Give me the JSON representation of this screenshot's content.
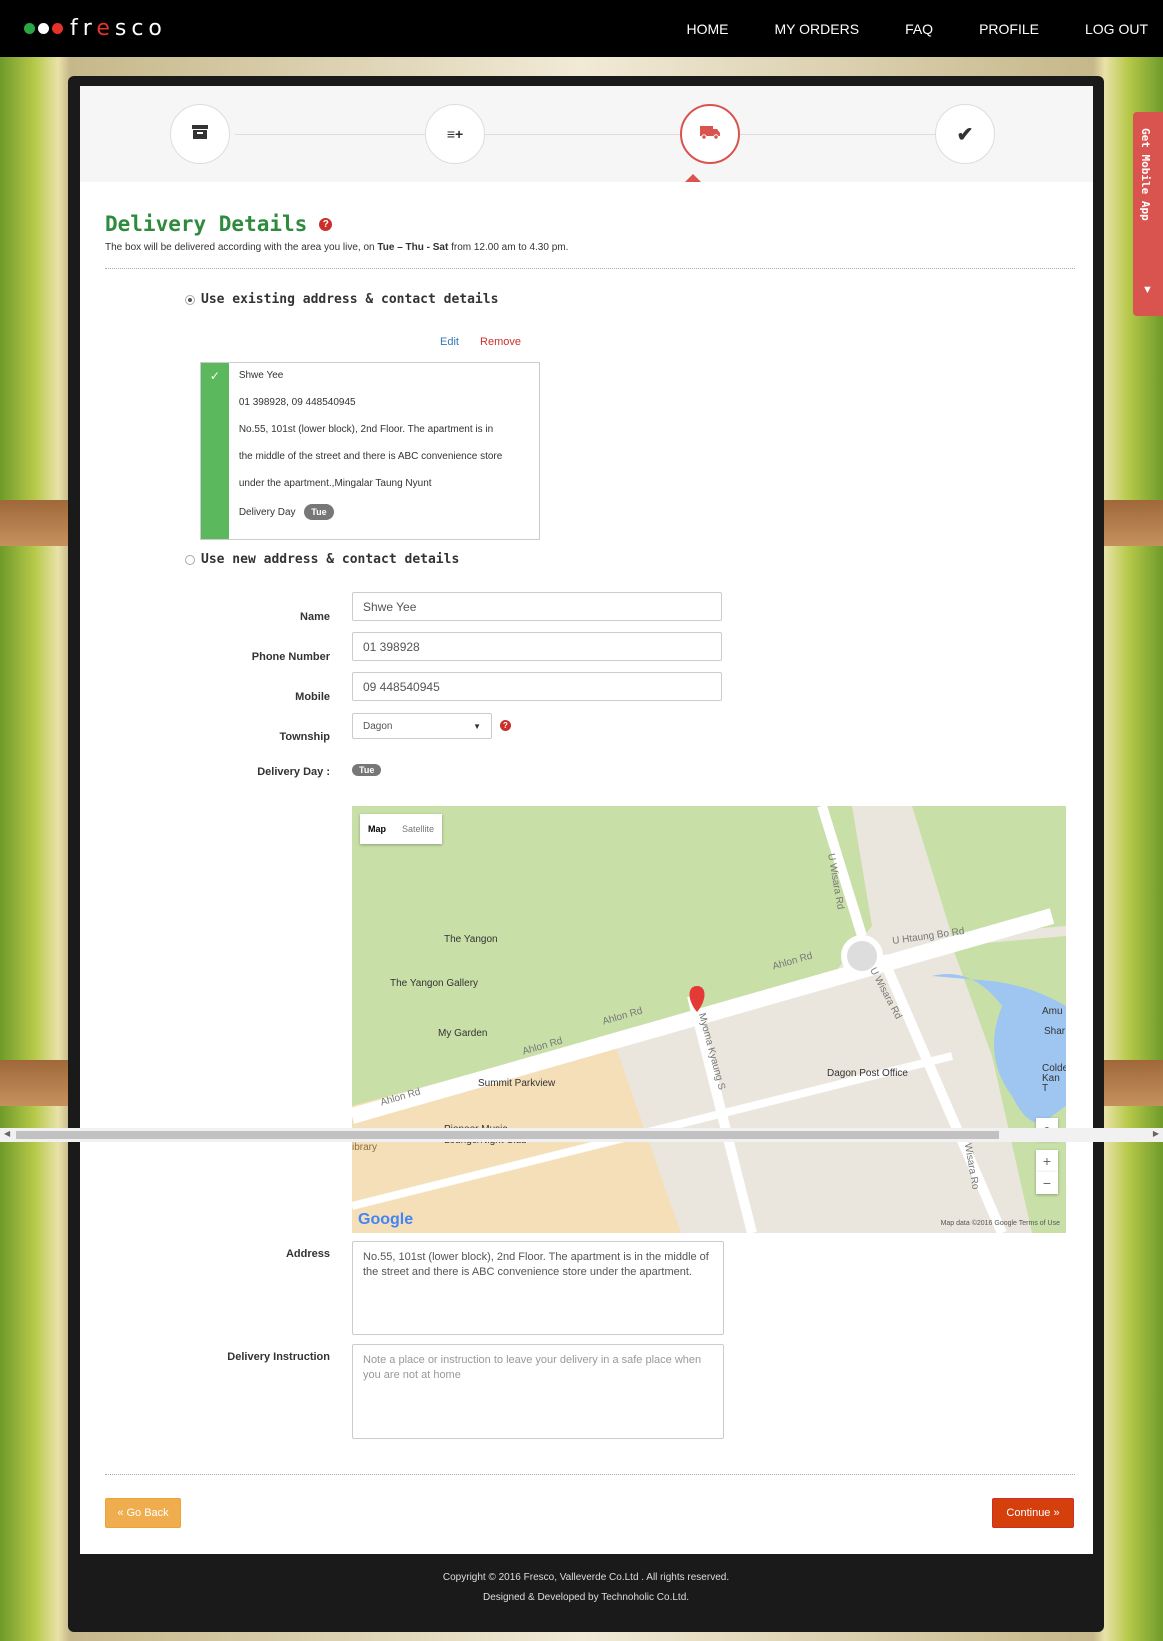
{
  "brand": {
    "name": "fresco",
    "dots": [
      "#28a745",
      "#ffffff",
      "#e5322b"
    ]
  },
  "nav": {
    "home": "HOME",
    "orders": "MY ORDERS",
    "faq": "FAQ",
    "profile": "PROFILE",
    "logout": "LOG OUT"
  },
  "side_tab": {
    "label": "Get Mobile App"
  },
  "steps": {
    "icons": [
      "box-icon",
      "list-plus-icon",
      "truck-icon",
      "check-icon"
    ],
    "active_index": 2
  },
  "delivery": {
    "title": "Delivery Details",
    "subtitle_prefix": "The box will be delivered according with the area you live, on ",
    "subtitle_days": "Tue – Thu - Sat",
    "subtitle_suffix": " from 12.00 am to 4.30 pm."
  },
  "existing": {
    "radio_label": "Use existing address & contact details",
    "edit": "Edit",
    "remove": "Remove",
    "name": "Shwe Yee",
    "phones": "01 398928, 09 448540945",
    "address_l1": "No.55, 101st (lower block), 2nd Floor. The apartment is in",
    "address_l2": "the middle of the street and there is ABC convenience store",
    "address_l3": "under the apartment.,Mingalar Taung Nyunt",
    "delivery_day_label": "Delivery Day",
    "delivery_day_badge": "Tue"
  },
  "new_address": {
    "radio_label": "Use new address & contact details",
    "name_label": "Name",
    "name_value": "Shwe Yee",
    "phone_label": "Phone Number",
    "phone_value": "01 398928",
    "mobile_label": "Mobile",
    "mobile_value": "09 448540945",
    "township_label": "Township",
    "township_value": "Dagon",
    "delivery_day_label": "Delivery Day :",
    "delivery_day_badge": "Tue",
    "address_label": "Address",
    "address_value": "No.55, 101st (lower block), 2nd Floor. The apartment is in the middle of the street and there is ABC convenience store under the apartment.",
    "instruction_label": "Delivery Instruction",
    "instruction_placeholder": "Note a place or instruction to leave your delivery in a safe place when you are not at home"
  },
  "map": {
    "type_map": "Map",
    "type_satellite": "Satellite",
    "labels": {
      "yangon": "The Yangon",
      "gallery": "The Yangon Gallery",
      "garden": "My Garden",
      "ahlon1": "Ahlon Rd",
      "ahlon2": "Ahlon Rd",
      "ahlon3": "Ahlon Rd",
      "ahlon4": "Ahlon Rd",
      "summit": "Summit Parkview",
      "pioneer": "Pioneer Music Lounge/Night Club",
      "library": "ibrary",
      "htaung": "U Htaung Bo Rd",
      "wisara1": "U Wisara Rd",
      "wisara2": "U Wisara Rd",
      "wisara3": "U Wisara Ro",
      "myoma": "Myoma Kyaung S",
      "post": "Dagon Post Office",
      "amu": "Amu",
      "shar": "Shar",
      "colde": "Colde Kan T"
    },
    "google": "Google",
    "attribution": "Map data ©2016 Google   Terms of Use",
    "zoom_in": "+",
    "zoom_out": "−"
  },
  "buttons": {
    "back": "« Go Back",
    "continue": "Continue »"
  },
  "footer": {
    "line1": "Copyright © 2016 Fresco, Valleverde Co.Ltd . All rights reserved.",
    "line2": "Designed & Developed by Technoholic Co.Ltd."
  }
}
